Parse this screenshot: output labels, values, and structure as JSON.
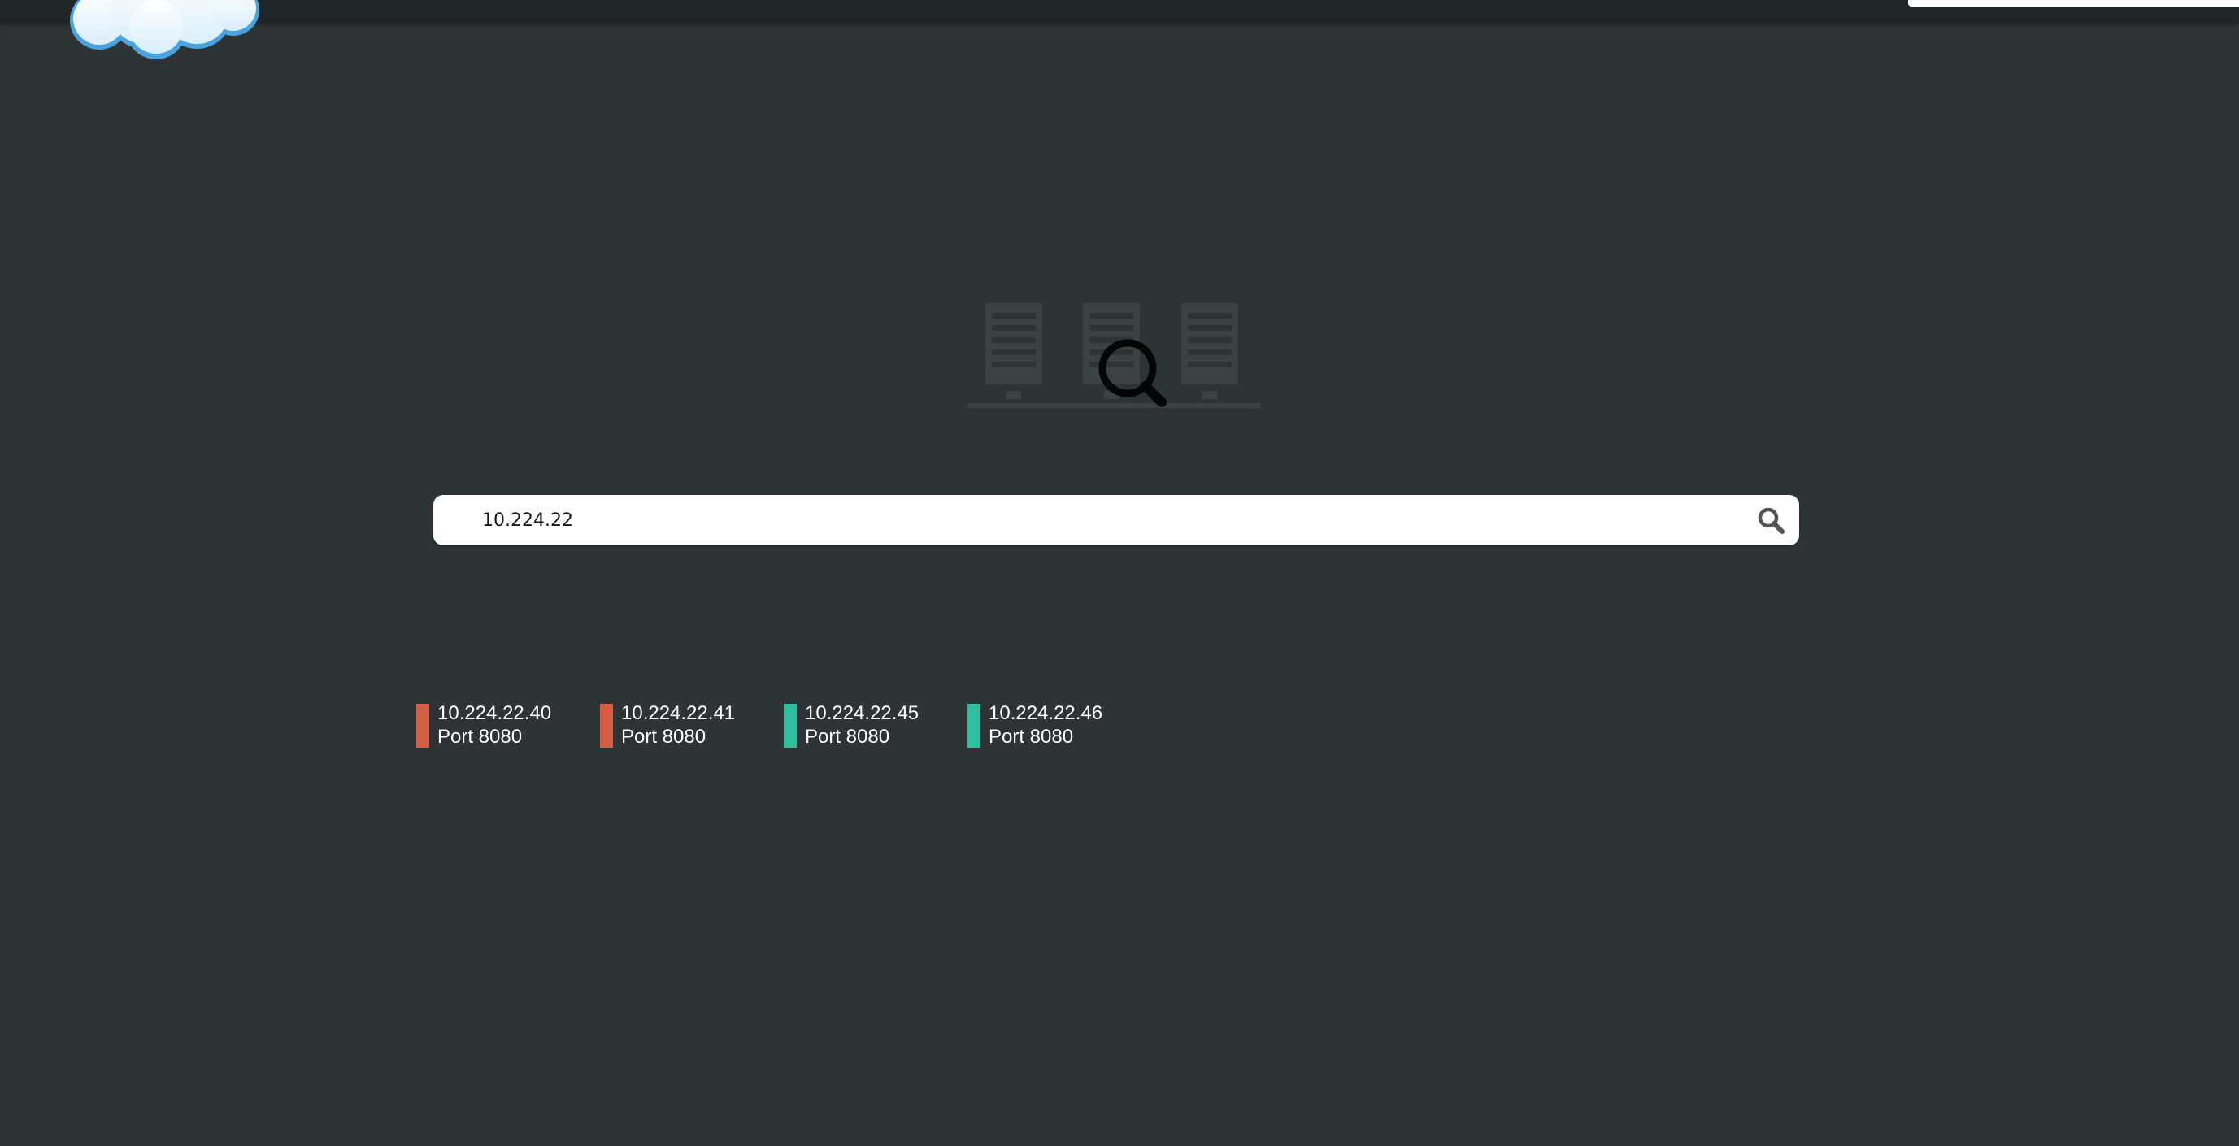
{
  "colors": {
    "background": "#2e3335",
    "topbar": "#202528",
    "status_down": "#d25f44",
    "status_up": "#2fbf9e"
  },
  "search": {
    "value": "10.224.22",
    "button_icon": "search-icon"
  },
  "hero": {
    "icon": "server-search-icon"
  },
  "logo": {
    "icon": "cloud-logo"
  },
  "results": [
    {
      "ip": "10.224.22.40",
      "port": "Port 8080",
      "status": "down"
    },
    {
      "ip": "10.224.22.41",
      "port": "Port 8080",
      "status": "down"
    },
    {
      "ip": "10.224.22.45",
      "port": "Port 8080",
      "status": "up"
    },
    {
      "ip": "10.224.22.46",
      "port": "Port 8080",
      "status": "up"
    }
  ]
}
